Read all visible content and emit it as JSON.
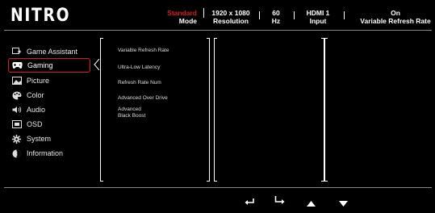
{
  "header": {
    "logo": "NITRO",
    "mode": {
      "value": "Standard",
      "label": "Mode",
      "value_color": "#e0161c"
    },
    "resolution": {
      "value": "1920 x 1080",
      "label": "Resolution"
    },
    "refresh": {
      "value": "60",
      "label": "Hz"
    },
    "input": {
      "value": "HDMI 1",
      "label": "Input"
    },
    "vrr": {
      "value": "On",
      "label": "Variable Refresh Rate"
    }
  },
  "sidebar": {
    "active_index": 1,
    "accent_color": "#e0161c",
    "items": [
      {
        "label": "Game Assistant",
        "icon": "game-assistant-icon"
      },
      {
        "label": "Gaming",
        "icon": "gamepad-icon"
      },
      {
        "label": "Picture",
        "icon": "picture-icon"
      },
      {
        "label": "Color",
        "icon": "palette-icon"
      },
      {
        "label": "Audio",
        "icon": "speaker-icon"
      },
      {
        "label": "OSD",
        "icon": "osd-icon"
      },
      {
        "label": "System",
        "icon": "gear-icon"
      },
      {
        "label": "Information",
        "icon": "info-icon"
      }
    ]
  },
  "submenu": {
    "items": [
      "Variable Refresh Rate",
      "Ultra-Low Latency",
      "Refresh Rate Num",
      "Advanced Over Drive",
      "Advanced\nBlack Boost"
    ]
  },
  "nav": {
    "back": "back-arrow-icon",
    "enter": "enter-arrow-icon",
    "up": "up-triangle-icon",
    "down": "down-triangle-icon"
  }
}
